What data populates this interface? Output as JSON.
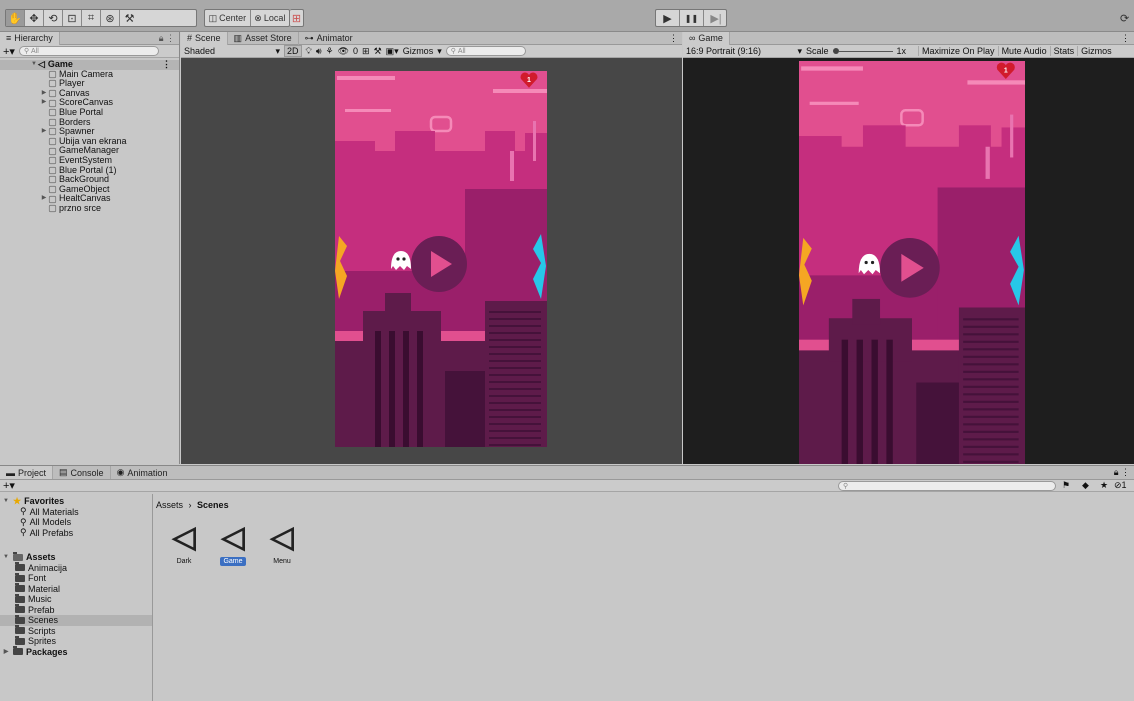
{
  "toolbar": {
    "center_label": "Center",
    "local_label": "Local"
  },
  "hierarchy": {
    "tab": "Hierarchy",
    "search_placeholder": "All",
    "scene": "Game",
    "items": [
      "Main Camera",
      "Player",
      "Canvas",
      "ScoreCanvas",
      "Blue Portal",
      "Borders",
      "Spawner",
      "Ubija van ekrana",
      "GameManager",
      "EventSystem",
      "Blue Portal (1)",
      "BackGround",
      "GameObject",
      "HealtCanvas",
      "przno srce"
    ]
  },
  "scene_view": {
    "tabs": [
      "Scene",
      "Asset Store",
      "Animator"
    ],
    "shading": "Shaded",
    "mode_2d": "2D",
    "hidden_count": "0",
    "gizmos": "Gizmos",
    "search_placeholder": "All"
  },
  "game_view": {
    "tab": "Game",
    "aspect": "16:9 Portrait (9:16)",
    "scale_label": "Scale",
    "scale_value": "1x",
    "buttons": [
      "Maximize On Play",
      "Mute Audio",
      "Stats",
      "Gizmos"
    ],
    "heart_value": "1"
  },
  "bottom": {
    "tabs": [
      "Project",
      "Console",
      "Animation"
    ],
    "breadcrumb_root": "Assets",
    "breadcrumb_current": "Scenes",
    "favorites_label": "Favorites",
    "favorites": [
      "All Materials",
      "All Models",
      "All Prefabs"
    ],
    "assets_label": "Assets",
    "asset_folders": [
      "Animacija",
      "Font",
      "Material",
      "Music",
      "Prefab",
      "Scenes",
      "Scripts",
      "Sprites"
    ],
    "packages_label": "Packages",
    "scene_assets": [
      "Dark",
      "Game",
      "Menu"
    ],
    "selected_asset": "Game",
    "selected_folder": "Scenes"
  },
  "colors": {
    "sky": "#e14f8f",
    "mid": "#c52e7e",
    "dark": "#5e1b4a",
    "orange": "#f5a623",
    "cyan": "#27c7e8",
    "heart": "#d11b2c"
  }
}
